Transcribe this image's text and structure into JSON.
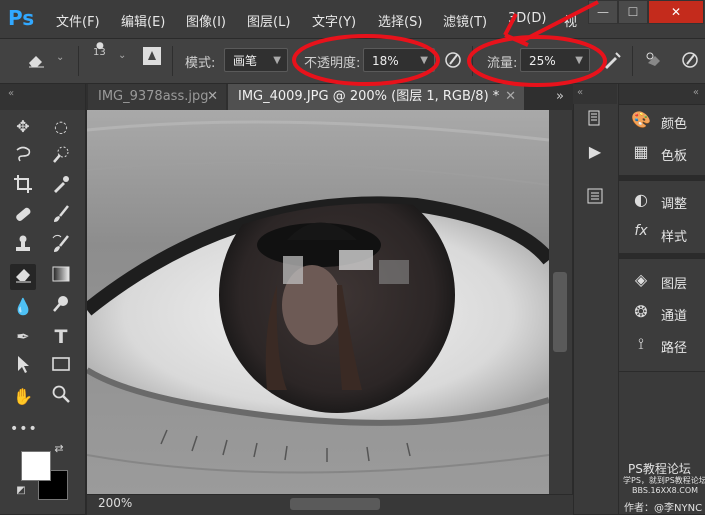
{
  "app": {
    "logo": "Ps",
    "menu": [
      "文件(F)",
      "编辑(E)",
      "图像(I)",
      "图层(L)",
      "文字(Y)",
      "选择(S)",
      "滤镜(T)",
      "3D(D)",
      "视"
    ],
    "window_controls": [
      "—",
      "☐",
      "✕"
    ]
  },
  "options": {
    "brush_size": "13",
    "mode_label": "模式:",
    "mode_value": "画笔",
    "opacity_label": "不透明度:",
    "opacity_value": "18%",
    "flow_label": "流量:",
    "flow_value": "25%"
  },
  "tabs": [
    {
      "label": "IMG_9378ass.jpg",
      "close": "✕"
    },
    {
      "label": "IMG_4009.JPG @ 200% (图层 1, RGB/8) *",
      "close": "✕"
    }
  ],
  "tabs_more": "»",
  "collapse_glyph": "«",
  "tools": [
    "move-icon",
    "marquee-icon",
    "lasso-icon",
    "quick-select-icon",
    "crop-icon",
    "eyedropper-icon",
    "healing-icon",
    "brush-icon",
    "stamp-icon",
    "history-brush-icon",
    "eraser-icon",
    "gradient-icon",
    "blur-icon",
    "dodge-icon",
    "pen-icon",
    "type-icon",
    "path-select-icon",
    "rectangle-icon",
    "hand-icon",
    "zoom-icon",
    "more-tools-icon"
  ],
  "colors": {
    "foreground": "#ffffff",
    "background": "#000000",
    "annotation": "#e8121b"
  },
  "status": {
    "zoom": "200%"
  },
  "panels": {
    "group1": [
      {
        "icon": "palette-icon",
        "label": "颜色"
      },
      {
        "icon": "swatches-icon",
        "label": "色板"
      }
    ],
    "group2": [
      {
        "icon": "adjustments-icon",
        "label": "调整"
      },
      {
        "icon": "styles-icon",
        "label": "样式"
      }
    ],
    "group3": [
      {
        "icon": "layers-icon",
        "label": "图层"
      },
      {
        "icon": "channels-icon",
        "label": "通道"
      },
      {
        "icon": "paths-icon",
        "label": "路径"
      }
    ]
  },
  "watermark": {
    "line1": "PS教程论坛",
    "line2": "学PS，就到PS教程论坛",
    "line3": "BBS.16XX8.COM",
    "line4": "作者：@李NYNC"
  }
}
